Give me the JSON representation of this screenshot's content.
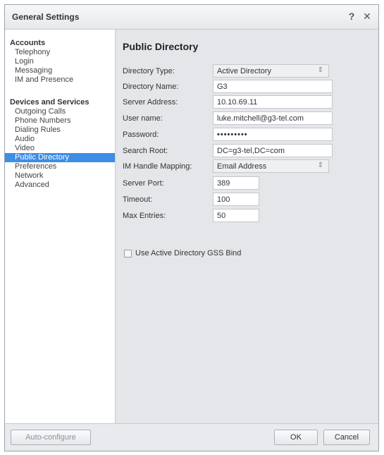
{
  "window": {
    "title": "General Settings",
    "help": "?",
    "close": "✕"
  },
  "sidebar": {
    "groups": [
      {
        "heading": "Accounts",
        "items": [
          "Telephony",
          "Login",
          "Messaging",
          "IM and Presence"
        ]
      },
      {
        "heading": "Devices and Services",
        "items": [
          "Outgoing Calls",
          "Phone Numbers",
          "Dialing Rules",
          "Audio",
          "Video",
          "Public Directory",
          "Preferences",
          "Network",
          "Advanced"
        ]
      }
    ],
    "selected": "Public Directory"
  },
  "main": {
    "title": "Public Directory",
    "fields": {
      "directory_type": {
        "label": "Directory Type:",
        "value": "Active Directory"
      },
      "directory_name": {
        "label": "Directory Name:",
        "value": "G3"
      },
      "server_address": {
        "label": "Server Address:",
        "value": "10.10.69.11"
      },
      "user_name": {
        "label": "User name:",
        "value": "luke.mitchell@g3-tel.com"
      },
      "password": {
        "label": "Password:",
        "value": "•••••••••"
      },
      "search_root": {
        "label": "Search Root:",
        "value": "DC=g3-tel,DC=com"
      },
      "im_handle_mapping": {
        "label": "IM Handle Mapping:",
        "value": "Email Address"
      },
      "server_port": {
        "label": "Server Port:",
        "value": "389"
      },
      "timeout": {
        "label": "Timeout:",
        "value": "100"
      },
      "max_entries": {
        "label": "Max Entries:",
        "value": "50"
      }
    },
    "gss_bind": {
      "label": "Use Active Directory GSS Bind",
      "checked": false
    }
  },
  "footer": {
    "auto_configure": "Auto-configure",
    "ok": "OK",
    "cancel": "Cancel"
  },
  "colors": {
    "selection": "#3d8ee6",
    "panel": "#e4e6e9"
  }
}
